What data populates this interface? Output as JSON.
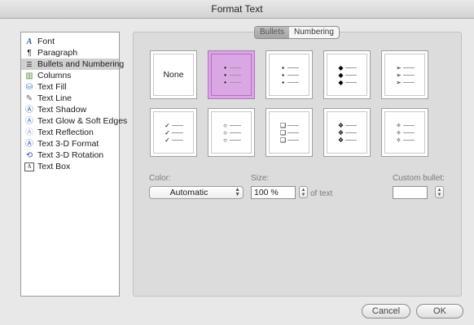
{
  "window": {
    "title": "Format Text"
  },
  "sidebar": {
    "items": [
      {
        "label": "Font",
        "icon": "font-icon",
        "selected": false
      },
      {
        "label": "Paragraph",
        "icon": "paragraph-icon",
        "selected": false
      },
      {
        "label": "Bullets and Numbering",
        "icon": "bullets-icon",
        "selected": true
      },
      {
        "label": "Columns",
        "icon": "columns-icon",
        "selected": false
      },
      {
        "label": "Text Fill",
        "icon": "paint-bucket-icon",
        "selected": false
      },
      {
        "label": "Text Line",
        "icon": "pencil-icon",
        "selected": false
      },
      {
        "label": "Text Shadow",
        "icon": "text-shadow-icon",
        "selected": false
      },
      {
        "label": "Text Glow & Soft Edges",
        "icon": "text-glow-icon",
        "selected": false
      },
      {
        "label": "Text Reflection",
        "icon": "text-reflection-icon",
        "selected": false
      },
      {
        "label": "Text 3-D Format",
        "icon": "text-3d-format-icon",
        "selected": false
      },
      {
        "label": "Text 3-D Rotation",
        "icon": "text-3d-rotation-icon",
        "selected": false
      },
      {
        "label": "Text Box",
        "icon": "text-box-icon",
        "selected": false
      }
    ]
  },
  "tabs": {
    "bullets": "Bullets",
    "numbering": "Numbering",
    "active": "Bullets"
  },
  "bullet_styles": {
    "none_label": "None",
    "selected_index": 1,
    "glyphs": [
      "",
      "•",
      "▪",
      "◆",
      "➢",
      "✓",
      "○",
      "❑",
      "❖",
      "✧"
    ]
  },
  "options": {
    "color_label": "Color:",
    "color_value": "Automatic",
    "size_label": "Size:",
    "size_value": "100 %",
    "of_text": "of text",
    "custom_bullet_label": "Custom bullet:",
    "custom_bullet_value": ""
  },
  "buttons": {
    "cancel": "Cancel",
    "ok": "OK"
  },
  "colors": {
    "selected_tile": "#dba6e4",
    "selected_tile_border": "#b36fc3"
  }
}
